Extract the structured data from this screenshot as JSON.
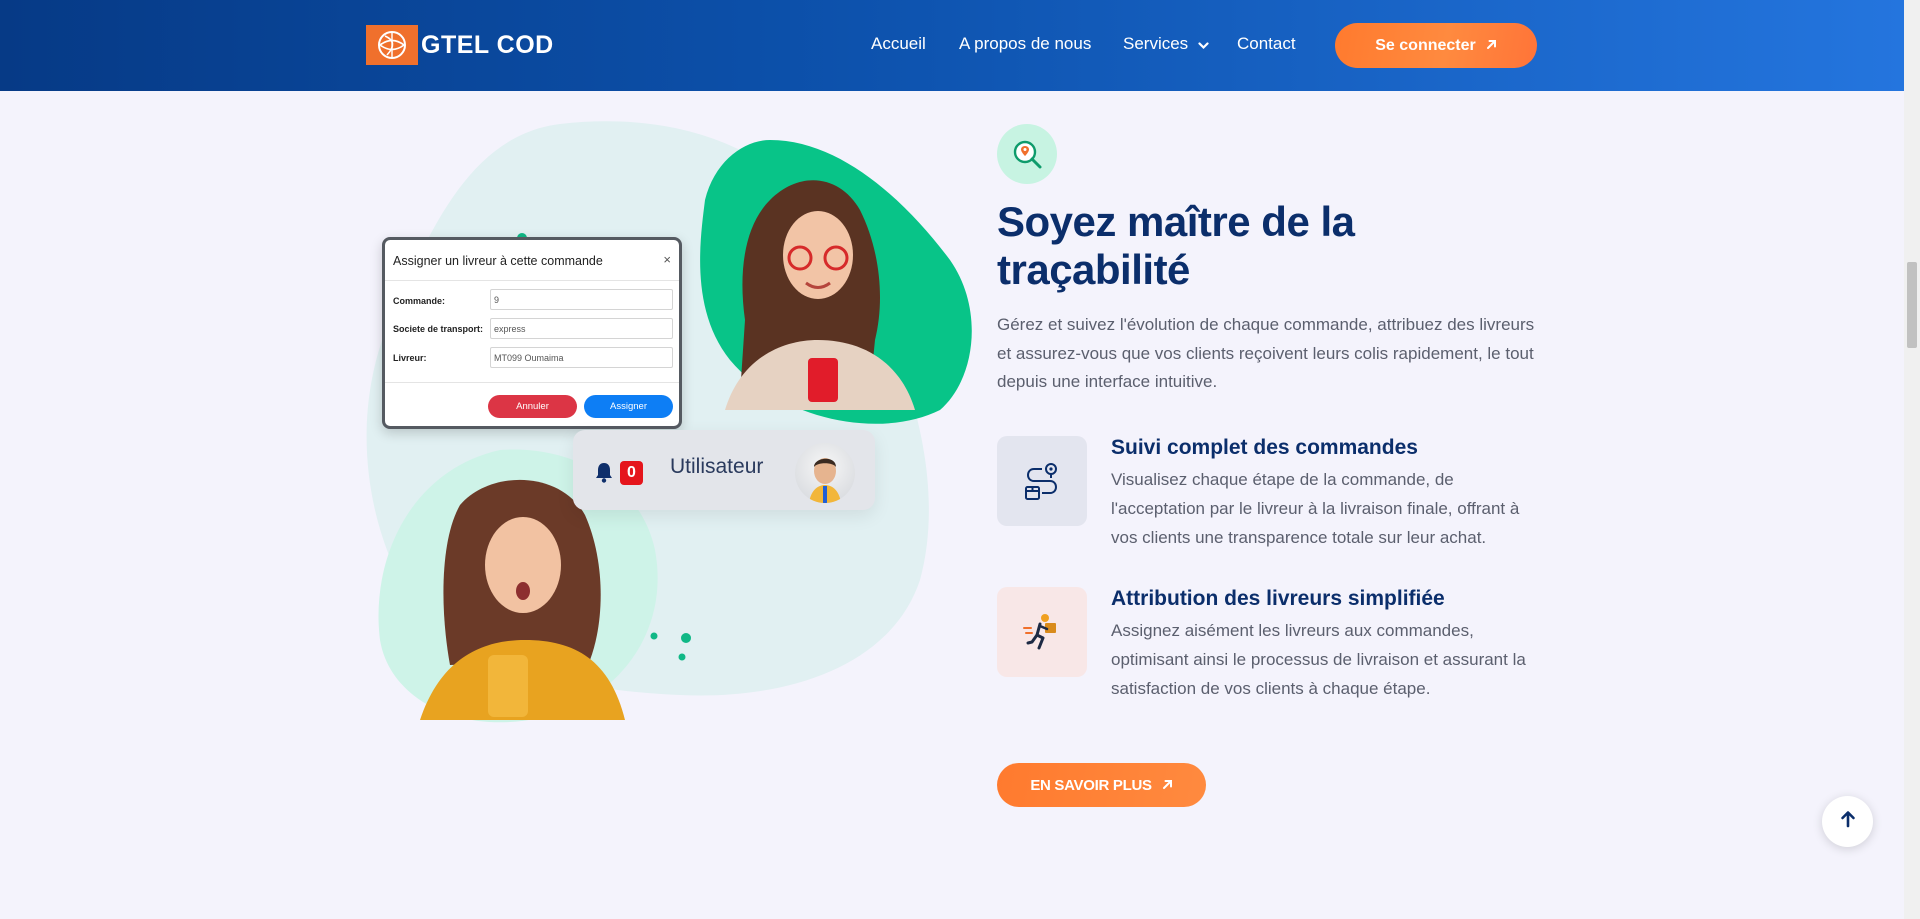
{
  "brand": {
    "name": "GTEL COD",
    "logo_icon": "globe-logo-icon",
    "accent": "#f0702c",
    "primary": "#0b2e6b"
  },
  "nav": {
    "items": [
      {
        "label": "Accueil"
      },
      {
        "label": "A propos de nous"
      },
      {
        "label": "Services",
        "has_dropdown": true
      },
      {
        "label": "Contact"
      }
    ],
    "login_label": "Se connecter"
  },
  "modal": {
    "title": "Assigner un livreur à cette commande",
    "close": "×",
    "fields": [
      {
        "label": "Commande:",
        "value": "9"
      },
      {
        "label": "Societe de transport:",
        "value": "express"
      },
      {
        "label": "Livreur:",
        "value": "MT099 Oumaima"
      }
    ],
    "cancel_label": "Annuler",
    "assign_label": "Assigner"
  },
  "user_card": {
    "notification_count": "0",
    "label": "Utilisateur"
  },
  "section": {
    "icon": "map-search-icon",
    "title": "Soyez maître de la traçabilité",
    "lead": "Gérez et suivez l'évolution de chaque commande, attribuez des livreurs et assurez-vous que vos clients reçoivent leurs colis rapidement, le tout depuis une interface intuitive.",
    "features": [
      {
        "icon": "route-tracking-icon",
        "title": "Suivi complet des commandes",
        "description": "Visualisez chaque étape de la commande, de l'acceptation par le livreur à la livraison finale, offrant à vos clients une transparence totale sur leur achat."
      },
      {
        "icon": "delivery-courier-icon",
        "title": "Attribution des livreurs simplifiée",
        "description": "Assignez aisément les livreurs aux commandes, optimisant ainsi le processus de livraison et assurant la satisfaction de vos clients à chaque étape."
      }
    ],
    "cta_label": "EN SAVOIR PLUS"
  }
}
